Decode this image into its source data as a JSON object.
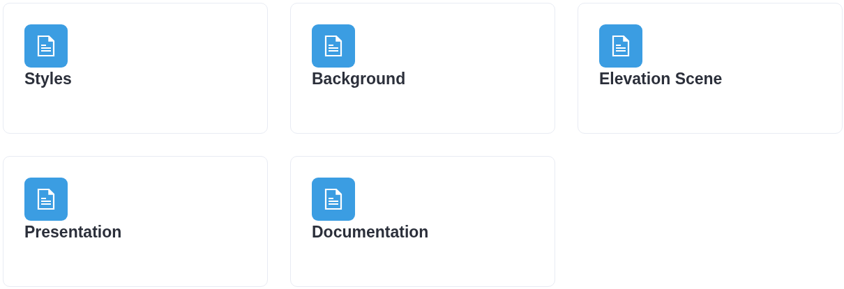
{
  "cards": [
    {
      "title": "Styles"
    },
    {
      "title": "Background"
    },
    {
      "title": "Elevation Scene"
    },
    {
      "title": "Presentation"
    },
    {
      "title": "Documentation"
    }
  ]
}
